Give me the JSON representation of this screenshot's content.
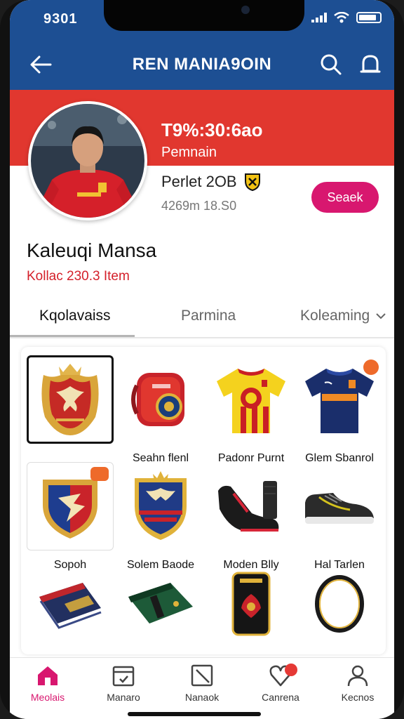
{
  "status_bar": {
    "time": "9301"
  },
  "app_bar": {
    "title": "REN MANIA9OIN"
  },
  "profile": {
    "stat_main": "T9%:30:6ao",
    "stat_sub": "Pemnain",
    "player_name": "Perlet 2OB",
    "player_stats": "4269m 18.S0",
    "action_button": "Seaek"
  },
  "collection": {
    "title": "Kaleuqi Mansa",
    "subtitle": "Kollac 230.3 Item"
  },
  "tabs": [
    {
      "label": "Kqolavaiss"
    },
    {
      "label": "Parmina"
    },
    {
      "label": "Koleaming"
    }
  ],
  "items": [
    {
      "label": "",
      "icon": "eagle-crest-badge-icon"
    },
    {
      "label": "Seahn flenl",
      "icon": "red-wristband-icon"
    },
    {
      "label": "Padonr Purnt",
      "icon": "yellow-jersey-icon"
    },
    {
      "label": "Glem Sbanrol",
      "icon": "navy-jersey-icon"
    },
    {
      "label": "Sopoh",
      "icon": "shield-badge-icon"
    },
    {
      "label": "Solem Baode",
      "icon": "eagle-shield-icon"
    },
    {
      "label": "Moden Blly",
      "icon": "black-boots-icon"
    },
    {
      "label": "Hal Tarlen",
      "icon": "sneaker-icon"
    },
    {
      "label": "",
      "icon": "navy-wallet-icon"
    },
    {
      "label": "",
      "icon": "green-wallet-icon"
    },
    {
      "label": "",
      "icon": "phone-case-icon"
    },
    {
      "label": "",
      "icon": "ring-icon"
    }
  ],
  "bottom_nav": [
    {
      "label": "Meolais",
      "icon": "home-icon"
    },
    {
      "label": "Manaro",
      "icon": "calendar-icon"
    },
    {
      "label": "Nanaok",
      "icon": "note-icon"
    },
    {
      "label": "Canrena",
      "icon": "heart-icon"
    },
    {
      "label": "Kecnos",
      "icon": "profile-icon"
    }
  ],
  "colors": {
    "header_blue": "#1d4f93",
    "banner_red": "#e1372f",
    "accent_pink": "#d8176f",
    "subtitle_red": "#d4202a"
  }
}
